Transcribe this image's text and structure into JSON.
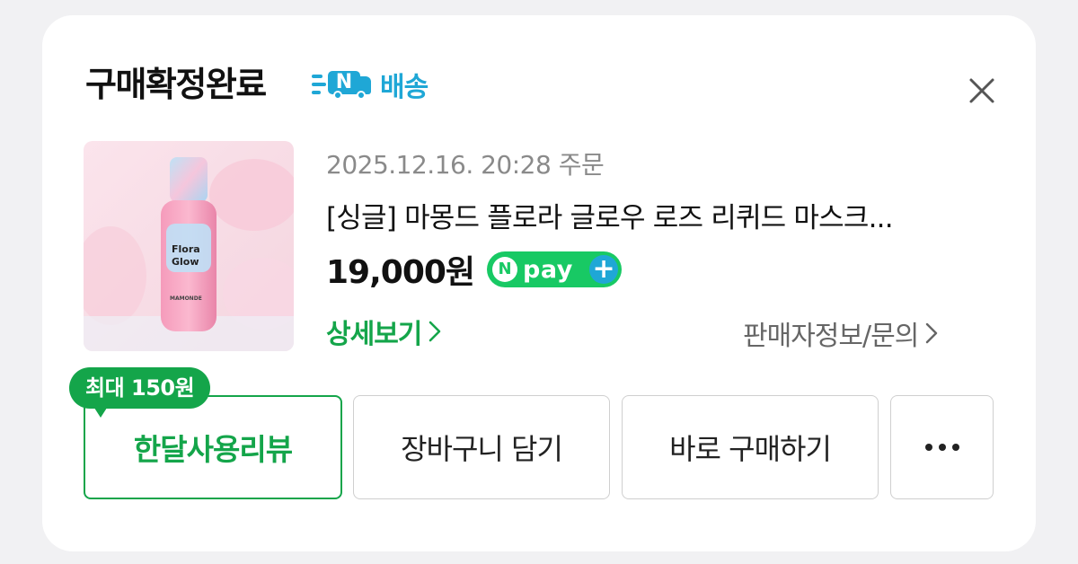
{
  "header": {
    "title": "구매확정완료",
    "delivery_badge_letter": "N",
    "delivery_label": "배송",
    "close_icon": "close-icon"
  },
  "order": {
    "date": "2025.12.16. 20:28 주문",
    "product_name": "[싱글] 마몽드 플로라 글로우 로즈 리퀴드 마스크...",
    "price": "19,000원",
    "product_image_label": "Flora Glow",
    "product_brand": "MAMONDE"
  },
  "npay": {
    "letter": "N",
    "label": "pay",
    "plus": "+"
  },
  "links": {
    "detail": "상세보기",
    "seller": "판매자정보/문의"
  },
  "actions": {
    "reward_bubble": "최대 150원",
    "review": "한달사용리뷰",
    "cart": "장바구니 담기",
    "buy": "바로 구매하기",
    "more_icon": "more-horizontal-icon"
  },
  "colors": {
    "accent_green": "#14a54a",
    "delivery_blue": "#1fa7d6",
    "npay_green": "#18c964"
  }
}
